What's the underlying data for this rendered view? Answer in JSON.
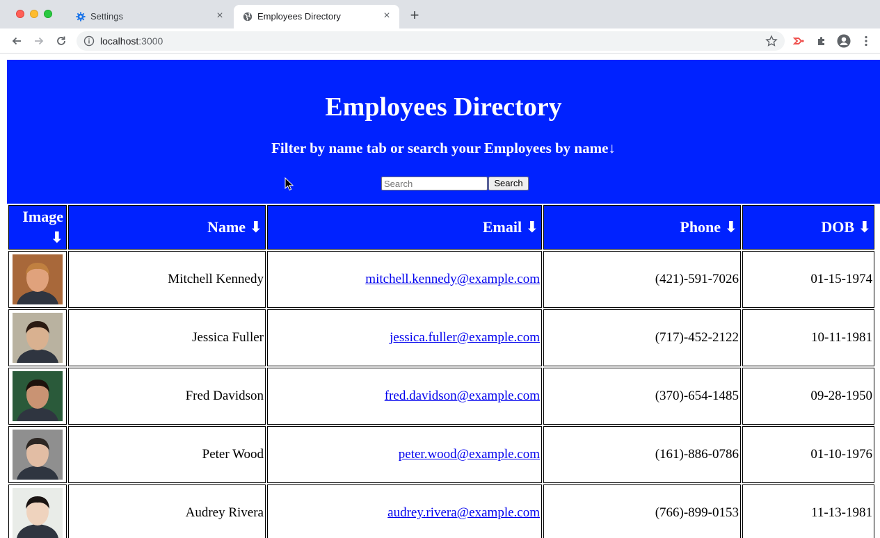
{
  "browser": {
    "tabs": [
      {
        "label": "Settings",
        "icon": "gear-icon",
        "active": false
      },
      {
        "label": "Employees Directory",
        "icon": "globe-icon",
        "active": true
      }
    ],
    "url_host": "localhost",
    "url_port": ":3000"
  },
  "page": {
    "title": "Employees Directory",
    "subtitle": "Filter by name tab or search your Employees by name↓",
    "search": {
      "placeholder": "Search",
      "button_label": "Search"
    },
    "accent_color": "#0022ff"
  },
  "table": {
    "headers": [
      {
        "label": "Image",
        "arrow": "⬇"
      },
      {
        "label": "Name",
        "arrow": "⬇"
      },
      {
        "label": "Email",
        "arrow": "⬇"
      },
      {
        "label": "Phone",
        "arrow": "⬇"
      },
      {
        "label": "DOB",
        "arrow": "⬇"
      }
    ],
    "rows": [
      {
        "name": "Mitchell Kennedy",
        "email": "mitchell.kennedy@example.com",
        "phone": "(421)-591-7026",
        "dob": "01-15-1974",
        "avatar_bg": "#a8683a",
        "avatar_skin": "#e0a27c",
        "avatar_hair": "#c08040"
      },
      {
        "name": "Jessica Fuller",
        "email": "jessica.fuller@example.com",
        "phone": "(717)-452-2122",
        "dob": "10-11-1981",
        "avatar_bg": "#b9b2a0",
        "avatar_skin": "#d9b190",
        "avatar_hair": "#2a1a12"
      },
      {
        "name": "Fred Davidson",
        "email": "fred.davidson@example.com",
        "phone": "(370)-654-1485",
        "dob": "09-28-1950",
        "avatar_bg": "#2a5a3a",
        "avatar_skin": "#c99373",
        "avatar_hair": "#1d120c"
      },
      {
        "name": "Peter Wood",
        "email": "peter.wood@example.com",
        "phone": "(161)-886-0786",
        "dob": "01-10-1976",
        "avatar_bg": "#8f8f8f",
        "avatar_skin": "#e2bda4",
        "avatar_hair": "#2c2622"
      },
      {
        "name": "Audrey Rivera",
        "email": "audrey.rivera@example.com",
        "phone": "(766)-899-0153",
        "dob": "11-13-1981",
        "avatar_bg": "#e9ece8",
        "avatar_skin": "#efd3be",
        "avatar_hair": "#1a1412"
      }
    ]
  }
}
